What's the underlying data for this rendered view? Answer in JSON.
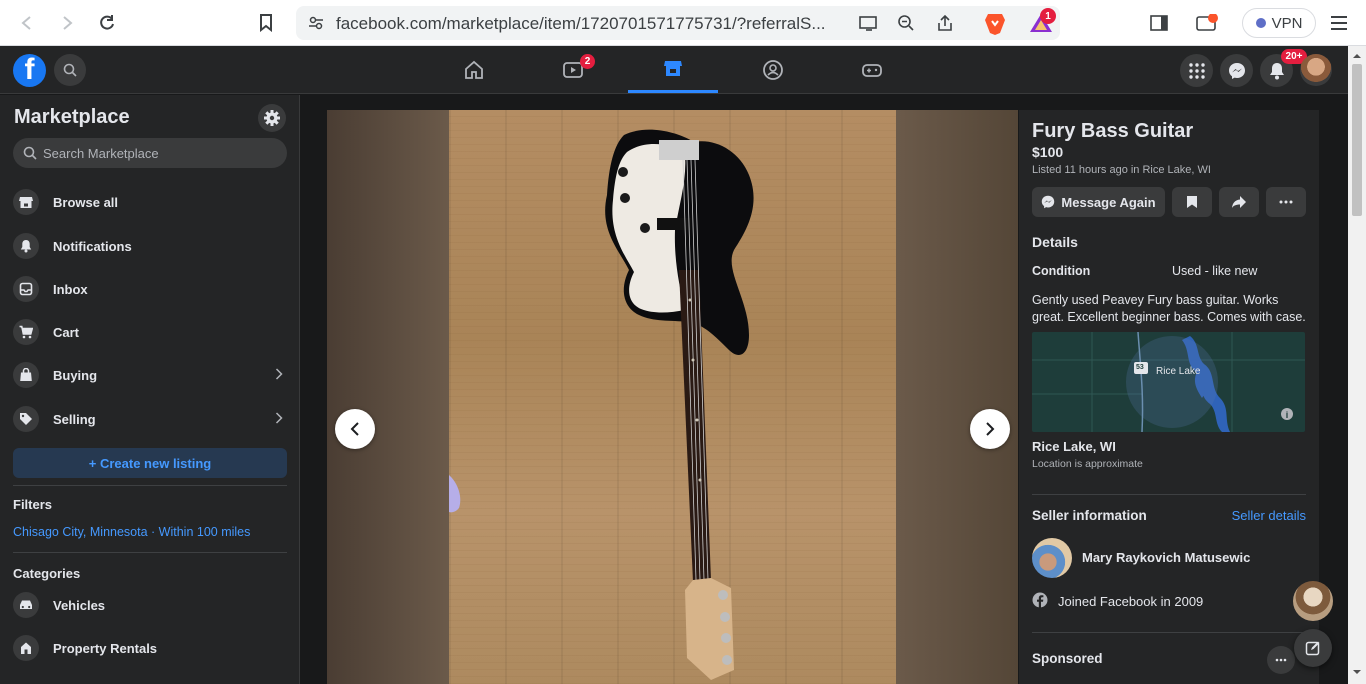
{
  "browser": {
    "url": "facebook.com/marketplace/item/1720701571775731/?referralS...",
    "rewards_badge": "1",
    "vpn_label": "VPN"
  },
  "topnav": {
    "watch_badge": "2",
    "notifications_badge": "20+"
  },
  "sidebar": {
    "title": "Marketplace",
    "search_placeholder": "Search Marketplace",
    "items": [
      {
        "label": "Browse all",
        "icon": "store-icon"
      },
      {
        "label": "Notifications",
        "icon": "bell-icon"
      },
      {
        "label": "Inbox",
        "icon": "inbox-icon"
      },
      {
        "label": "Cart",
        "icon": "cart-icon"
      },
      {
        "label": "Buying",
        "icon": "bag-icon"
      },
      {
        "label": "Selling",
        "icon": "tag-icon"
      }
    ],
    "create_listing": "+ Create new listing",
    "filters_heading": "Filters",
    "filters_location": "Chisago City, Minnesota · Within 100 miles",
    "categories_heading": "Categories",
    "categories": [
      {
        "label": "Vehicles",
        "icon": "car-icon"
      },
      {
        "label": "Property Rentals",
        "icon": "house-icon"
      }
    ]
  },
  "listing": {
    "title": "Fury Bass Guitar",
    "price": "$100",
    "meta": "Listed 11 hours ago in Rice Lake, WI",
    "message_btn": "Message Again",
    "details_heading": "Details",
    "condition_label": "Condition",
    "condition_value": "Used - like new",
    "description": "Gently used Peavey Fury bass guitar.  Works great.  Excellent beginner bass.  Comes with case.",
    "map_label": "Rice Lake",
    "map_shield": "53",
    "location": "Rice Lake, WI",
    "location_note": "Location is approximate",
    "seller_heading": "Seller information",
    "seller_details_link": "Seller details",
    "seller_name": "Mary Raykovich Matusewic",
    "joined": "Joined Facebook in 2009",
    "sponsored": "Sponsored"
  },
  "colors": {
    "accent": "#2d88ff",
    "link": "#4599ff",
    "panel": "#242526",
    "bg": "#18191a"
  }
}
